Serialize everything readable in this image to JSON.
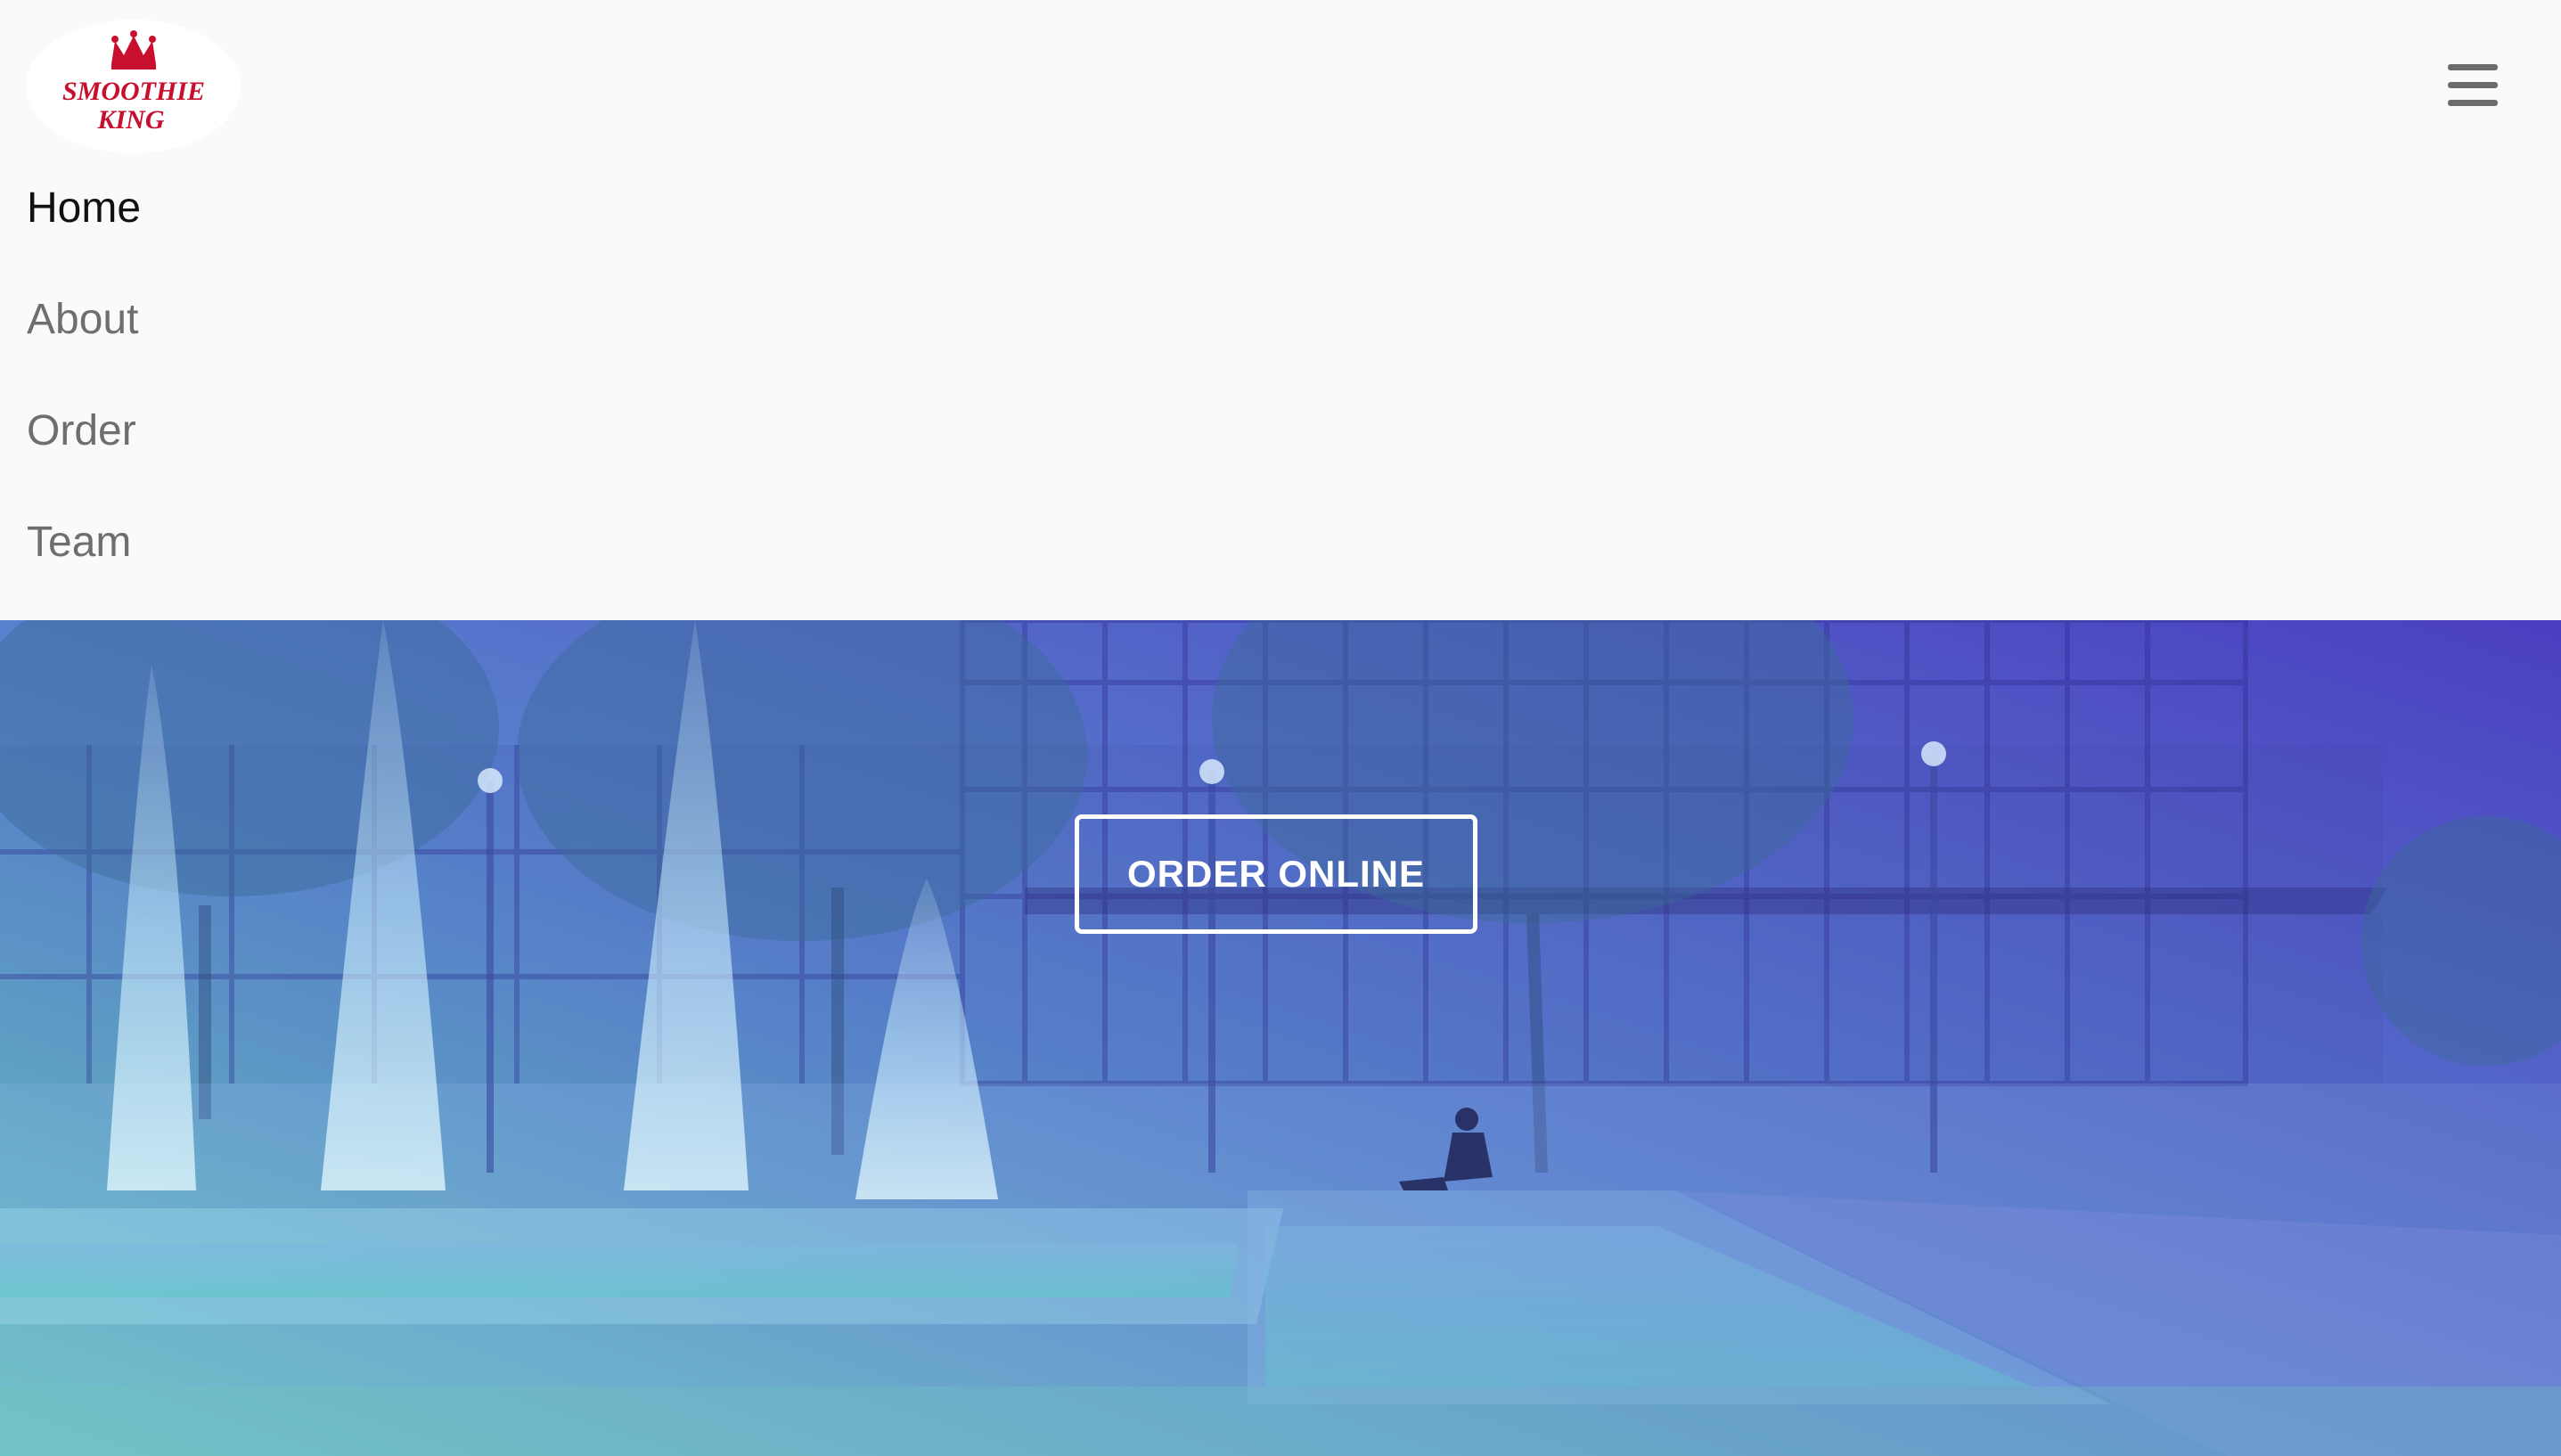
{
  "brand": {
    "logo_line1": "SMOOTHIE",
    "logo_line2": "KING",
    "logo_color": "#c8102e"
  },
  "header": {
    "menu_icon": "hamburger-menu-icon"
  },
  "nav": {
    "items": [
      {
        "label": "Home",
        "active": true
      },
      {
        "label": "About",
        "active": false
      },
      {
        "label": "Order",
        "active": false
      },
      {
        "label": "Team",
        "active": false
      }
    ]
  },
  "hero": {
    "cta_label": "ORDER ONLINE",
    "overlay_colors": [
      "#6fd6c4",
      "#4b3fc0"
    ]
  }
}
